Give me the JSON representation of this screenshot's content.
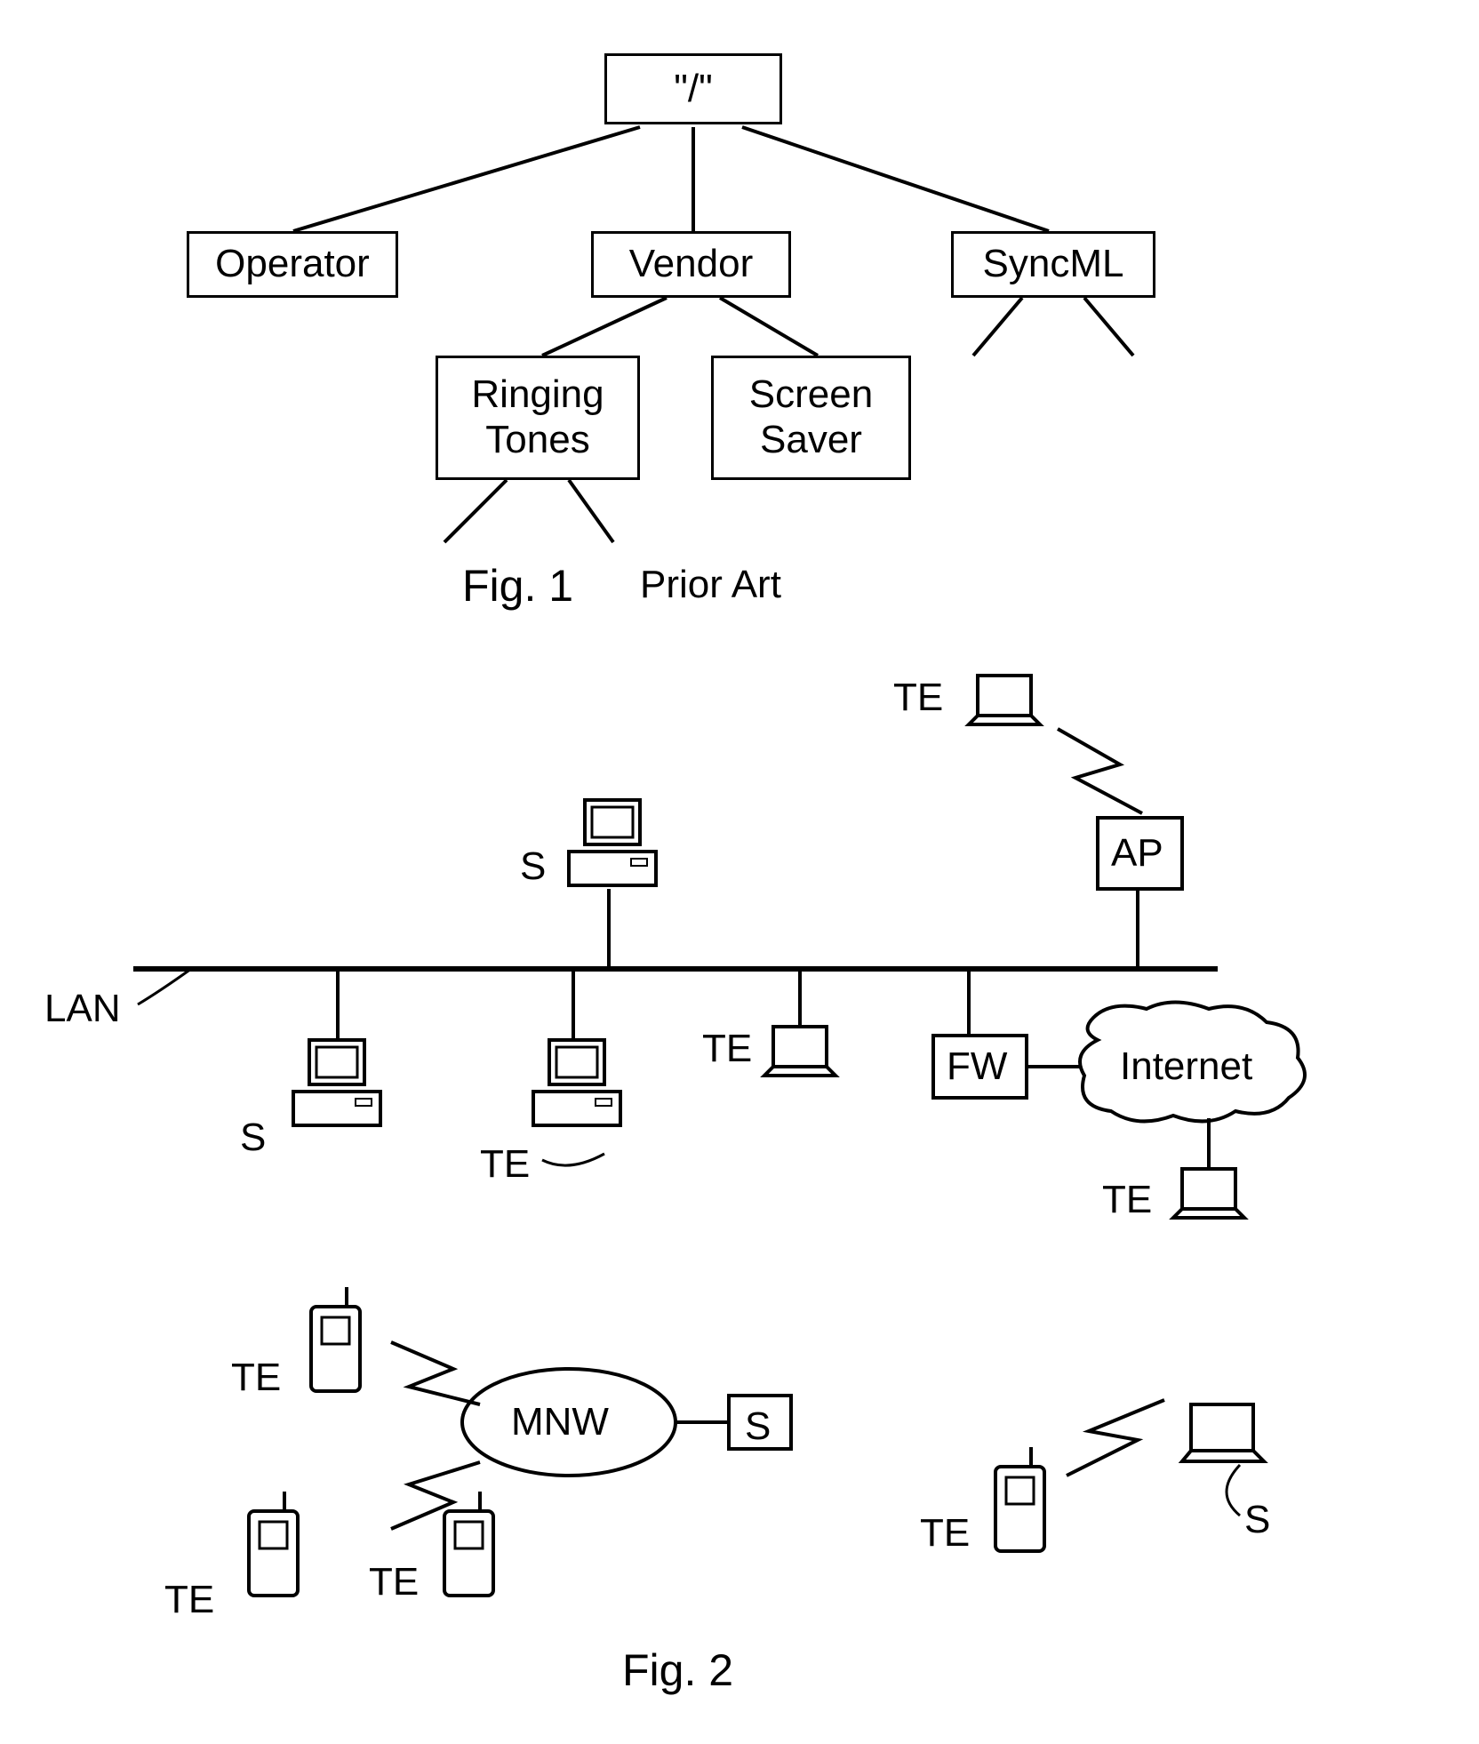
{
  "fig1": {
    "root": "\"/\"",
    "operator": "Operator",
    "vendor": "Vendor",
    "syncml": "SyncML",
    "ringing": "Ringing\nTones",
    "screen": "Screen\nSaver",
    "caption": "Fig. 1",
    "caption_note": "Prior Art"
  },
  "fig2": {
    "labels": {
      "te": "TE",
      "s": "S",
      "ap": "AP",
      "lan": "LAN",
      "fw": "FW",
      "internet": "Internet",
      "mnw": "MNW"
    },
    "caption": "Fig. 2"
  }
}
